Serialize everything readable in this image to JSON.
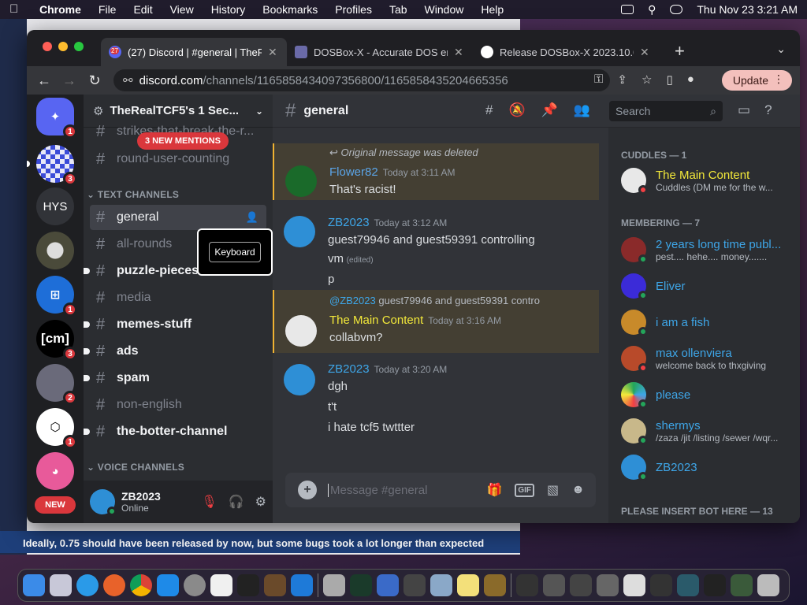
{
  "menubar": {
    "app": "Chrome",
    "items": [
      "File",
      "Edit",
      "View",
      "History",
      "Bookmarks",
      "Profiles",
      "Tab",
      "Window",
      "Help"
    ],
    "clock": "Thu Nov 23  3:21 AM"
  },
  "background_text": "Ideally, 0.75 should have been released by now, but some bugs took a lot longer than expected",
  "browser": {
    "tabs": [
      {
        "title": "(27) Discord | #general | TheRe",
        "badge": "27",
        "active": true
      },
      {
        "title": "DOSBox-X - Accurate DOS em",
        "active": false
      },
      {
        "title": "Release DOSBox-X 2023.10.06",
        "active": false
      }
    ],
    "url_host": "discord.com",
    "url_path": "/channels/1165858434097356800/1165858435204665356",
    "update_label": "Update"
  },
  "guilds": [
    {
      "label": "",
      "badge": "1",
      "color": "#5865f2",
      "icon": "discord-home-icon"
    },
    {
      "label": "",
      "badge": "3",
      "color": "#4a6ad8",
      "icon": "checker-server-icon"
    },
    {
      "label": "HYS",
      "badge": "",
      "color": "#2b2d31",
      "icon": ""
    },
    {
      "label": "",
      "badge": "",
      "color": "#4a4a3a",
      "icon": "fish-server-icon"
    },
    {
      "label": "",
      "badge": "1",
      "color": "#1e6ed8",
      "icon": "windows-server-icon"
    },
    {
      "label": "[cm]",
      "badge": "3",
      "color": "#000000",
      "icon": ""
    },
    {
      "label": "",
      "badge": "2",
      "color": "#555566",
      "icon": "character-server-icon"
    },
    {
      "label": "",
      "badge": "1",
      "color": "#ffffff",
      "icon": "hexagon-server-icon"
    },
    {
      "label": "",
      "badge": "",
      "color": "#e85a9a",
      "icon": "pink-server-icon"
    }
  ],
  "new_label": "NEW",
  "server": {
    "name": "TheRealTCF5's 1 Sec...",
    "mentions_label": "3 NEW MENTIONS",
    "top_channels": [
      {
        "name": "strikes-that-break-the-r...",
        "unread": false
      },
      {
        "name": "round-user-counting",
        "unread": false
      }
    ],
    "text_category": "TEXT CHANNELS",
    "channels": [
      {
        "name": "general",
        "unread": false,
        "selected": true
      },
      {
        "name": "all-rounds",
        "unread": false
      },
      {
        "name": "puzzle-pieces",
        "unread": true
      },
      {
        "name": "media",
        "unread": false
      },
      {
        "name": "memes-stuff",
        "unread": true
      },
      {
        "name": "ads",
        "unread": true
      },
      {
        "name": "spam",
        "unread": true
      },
      {
        "name": "non-english",
        "unread": false
      },
      {
        "name": "the-botter-channel",
        "unread": true
      }
    ],
    "voice_category": "VOICE CHANNELS"
  },
  "tooltip": "Keyboard",
  "user": {
    "name": "ZB2023",
    "status": "Online"
  },
  "chat": {
    "channel": "general",
    "search_placeholder": "Search",
    "messages": [
      {
        "reply": "Original message was deleted",
        "author": "Flower82",
        "author_color": "#5ba5e8",
        "time": "Today at 3:11 AM",
        "lines": [
          "That's racist!"
        ],
        "highlight": true
      },
      {
        "author": "ZB2023",
        "author_color": "#3ea6e8",
        "time": "Today at 3:12 AM",
        "lines": [
          "guest79946 and guest59391 controlling",
          "vm",
          "p"
        ],
        "edited": "(edited)"
      },
      {
        "reply_author": "@ZB2023",
        "reply": "guest79946 and guest59391 contro",
        "author": "The Main Content",
        "author_color": "#f3e93a",
        "time": "Today at 3:16 AM",
        "lines": [
          "collabvm?"
        ],
        "highlight": true
      },
      {
        "author": "ZB2023",
        "author_color": "#3ea6e8",
        "time": "Today at 3:20 AM",
        "lines": [
          "dgh",
          "t't",
          "i hate tcf5 twttter"
        ]
      }
    ],
    "composer_placeholder": "Message #general",
    "gif_label": "GIF"
  },
  "members": {
    "groups": [
      {
        "title": "CUDDLES — 1",
        "items": [
          {
            "name": "The Main Content",
            "activity": "Cuddles (DM me for the w...",
            "color": "#f3e93a",
            "status": "#f23f43"
          }
        ]
      },
      {
        "title": "MEMBERING — 7",
        "items": [
          {
            "name": "2 years long time publ...",
            "activity": "pest.... hehe.... money.......",
            "color": "#3ea6e8",
            "status": "#23a55a"
          },
          {
            "name": "Eliver",
            "activity": "",
            "color": "#3ea6e8",
            "status": "#23a55a"
          },
          {
            "name": "i am a fish",
            "activity": "",
            "color": "#3ea6e8",
            "status": "#23a55a"
          },
          {
            "name": "max ollenviera",
            "activity": "welcome back to thxgiving",
            "color": "#3ea6e8",
            "status": "#f23f43"
          },
          {
            "name": "please",
            "activity": "",
            "color": "#3ea6e8",
            "status": "#23a55a"
          },
          {
            "name": "shermys",
            "activity": "/zaza /jit /listing /sewer /wqr...",
            "color": "#3ea6e8",
            "status": "#23a55a"
          },
          {
            "name": "ZB2023",
            "activity": "",
            "color": "#3ea6e8",
            "status": "#23a55a"
          }
        ]
      },
      {
        "title": "PLEASE INSERT BOT HERE — 13",
        "items": []
      }
    ]
  },
  "accent": "#5865f2"
}
